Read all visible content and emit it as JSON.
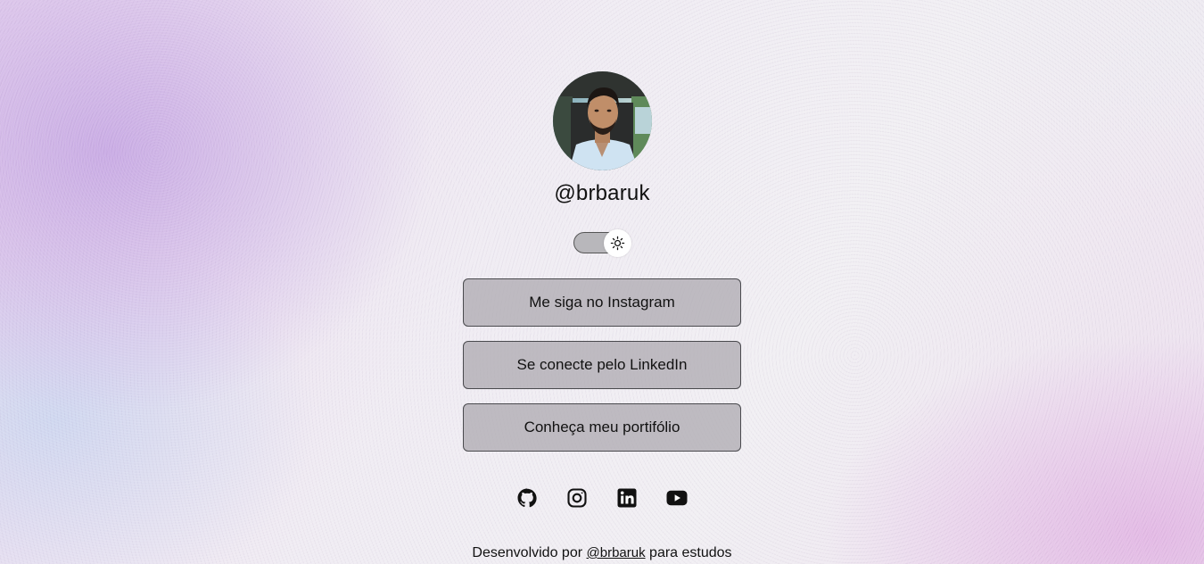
{
  "profile": {
    "handle": "@brbaruk"
  },
  "theme_toggle": {
    "icon": "sun-icon"
  },
  "links": [
    {
      "label": "Me siga no Instagram"
    },
    {
      "label": "Se conecte pelo LinkedIn"
    },
    {
      "label": "Conheça meu portifólio"
    }
  ],
  "socials": [
    {
      "icon": "github-icon"
    },
    {
      "icon": "instagram-icon"
    },
    {
      "icon": "linkedin-icon"
    },
    {
      "icon": "youtube-icon"
    }
  ],
  "footer": {
    "prefix": "Desenvolvido por",
    "link": "@brbaruk",
    "suffix": "para estudos"
  }
}
